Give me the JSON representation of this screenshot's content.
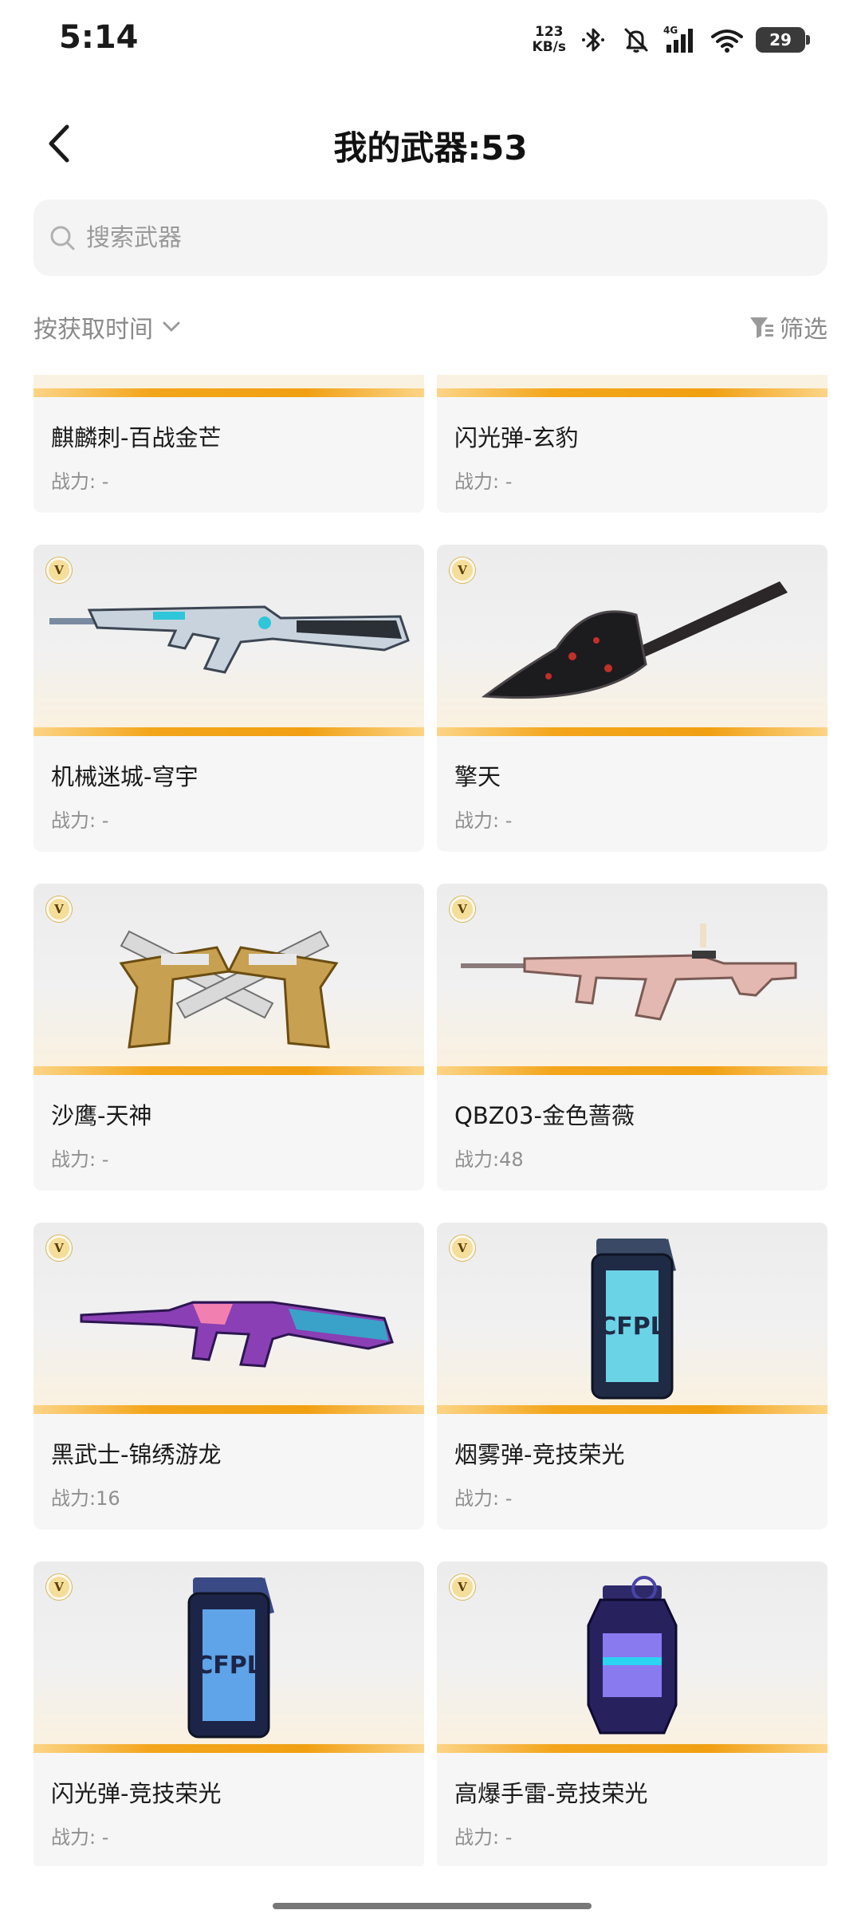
{
  "status_bar": {
    "time": "5:14",
    "net_speed_value": "123",
    "net_speed_unit": "KB/s",
    "network_type": "4G",
    "battery": "29"
  },
  "header": {
    "title": "我的武器:53"
  },
  "search": {
    "placeholder": "搜索武器"
  },
  "sort": {
    "label": "按获取时间"
  },
  "filter": {
    "label": "筛选"
  },
  "badge_letter": "V",
  "weapons": [
    {
      "name": "麒麟刺-百战金芒",
      "power": "战力: -",
      "badge": false,
      "art": "none"
    },
    {
      "name": "闪光弹-玄豹",
      "power": "战力: -",
      "badge": false,
      "art": "none"
    },
    {
      "name": "机械迷城-穹宇",
      "power": "战力: -",
      "badge": true,
      "art": "rifle-silver"
    },
    {
      "name": "擎天",
      "power": "战力: -",
      "badge": true,
      "art": "shovel-black"
    },
    {
      "name": "沙鹰-天神",
      "power": "战力: -",
      "badge": true,
      "art": "dual-pistols-gold"
    },
    {
      "name": "QBZ03-金色蔷薇",
      "power": "战力:48",
      "badge": true,
      "art": "rifle-pink"
    },
    {
      "name": "黑武士-锦绣游龙",
      "power": "战力:16",
      "badge": true,
      "art": "rifle-purple"
    },
    {
      "name": "烟雾弹-竞技荣光",
      "power": "战力: -",
      "badge": true,
      "art": "grenade-cyan"
    },
    {
      "name": "闪光弹-竞技荣光",
      "power": "战力: -",
      "badge": true,
      "art": "grenade-blue"
    },
    {
      "name": "高爆手雷-竞技荣光",
      "power": "战力: -",
      "badge": true,
      "art": "grenade-purple"
    }
  ],
  "colors": {
    "accent_orange": "#f3a51b",
    "card_bg": "#f6f6f6",
    "muted_text": "#8f8f8f"
  }
}
